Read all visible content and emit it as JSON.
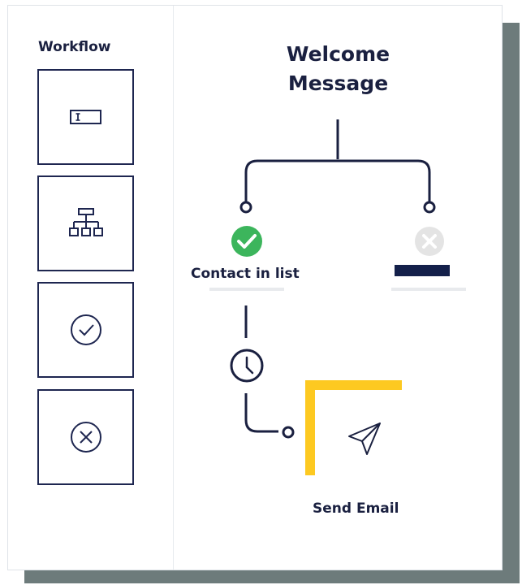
{
  "sidebar": {
    "title": "Workflow",
    "tools": [
      {
        "name": "text-input-tool",
        "icon": "text-field-icon"
      },
      {
        "name": "hierarchy-tool",
        "icon": "hierarchy-icon"
      },
      {
        "name": "check-tool",
        "icon": "check-circle-icon"
      },
      {
        "name": "cancel-tool",
        "icon": "x-circle-icon"
      }
    ]
  },
  "flow": {
    "title_line1": "Welcome",
    "title_line2": "Message",
    "yes_branch": {
      "label": "Contact in list",
      "icon": "check-circle-icon",
      "color": "#3cb55c"
    },
    "no_branch": {
      "label": "",
      "icon": "x-circle-icon",
      "color": "#e4e4e4"
    },
    "delay_icon": "clock-icon",
    "action": {
      "label": "Send Email",
      "icon": "send-icon",
      "accent": "#fdc921"
    }
  },
  "colors": {
    "navy": "#1a2040",
    "shadow": "#6d7b7b"
  }
}
